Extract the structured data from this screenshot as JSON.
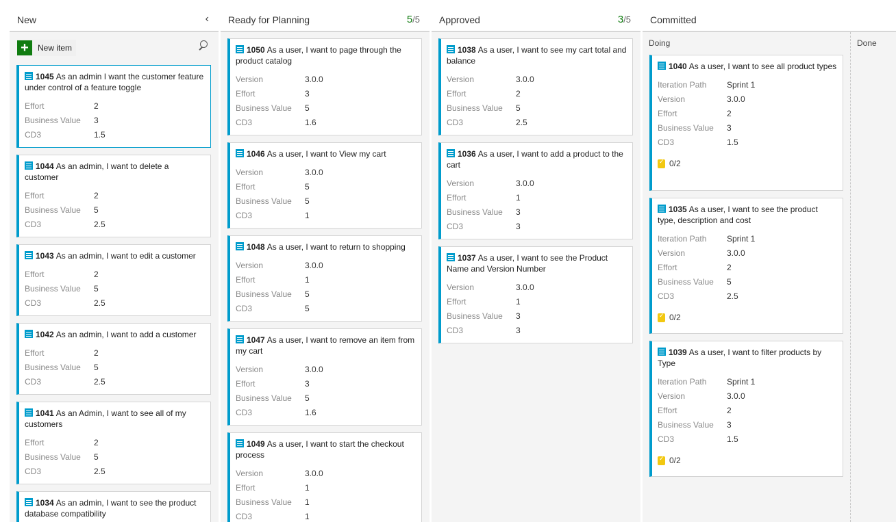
{
  "columns": {
    "new": {
      "title": "New",
      "new_item_label": "New item"
    },
    "ready": {
      "title": "Ready for Planning",
      "count": "5",
      "limit": "/5"
    },
    "approved": {
      "title": "Approved",
      "count": "3",
      "limit": "/5"
    },
    "committed": {
      "title": "Committed",
      "doing": "Doing",
      "done": "Done"
    }
  },
  "field_labels": {
    "effort": "Effort",
    "business_value": "Business Value",
    "cd3": "CD3",
    "version": "Version",
    "iteration_path": "Iteration Path"
  },
  "cards": {
    "c1045": {
      "id": "1045",
      "title": "As an admin I want the customer feature under control of a feature toggle",
      "effort": "2",
      "business_value": "3",
      "cd3": "1.5"
    },
    "c1044": {
      "id": "1044",
      "title": "As an admin, I want to delete a customer",
      "effort": "2",
      "business_value": "5",
      "cd3": "2.5"
    },
    "c1043": {
      "id": "1043",
      "title": "As an admin, I want to edit a customer",
      "effort": "2",
      "business_value": "5",
      "cd3": "2.5"
    },
    "c1042": {
      "id": "1042",
      "title": "As an admin, I want to add a customer",
      "effort": "2",
      "business_value": "5",
      "cd3": "2.5"
    },
    "c1041": {
      "id": "1041",
      "title": "As an Admin, I want to see all of my customers",
      "effort": "2",
      "business_value": "5",
      "cd3": "2.5"
    },
    "c1034": {
      "id": "1034",
      "title": "As an admin, I want to see the product database compatibility"
    },
    "c1050": {
      "id": "1050",
      "title": "As a user, I want to page through the product catalog",
      "version": "3.0.0",
      "effort": "3",
      "business_value": "5",
      "cd3": "1.6"
    },
    "c1046": {
      "id": "1046",
      "title": "As a user, I want to View my cart",
      "version": "3.0.0",
      "effort": "5",
      "business_value": "5",
      "cd3": "1"
    },
    "c1048": {
      "id": "1048",
      "title": "As a user, I want to return to shopping",
      "version": "3.0.0",
      "effort": "1",
      "business_value": "5",
      "cd3": "5"
    },
    "c1047": {
      "id": "1047",
      "title": "As a user, I want to remove an item from my cart",
      "version": "3.0.0",
      "effort": "3",
      "business_value": "5",
      "cd3": "1.6"
    },
    "c1049": {
      "id": "1049",
      "title": "As a user, I want to start the checkout process",
      "version": "3.0.0",
      "effort": "1",
      "business_value": "1",
      "cd3": "1"
    },
    "c1038": {
      "id": "1038",
      "title": "As a user, I want to see my cart total and balance",
      "version": "3.0.0",
      "effort": "2",
      "business_value": "5",
      "cd3": "2.5"
    },
    "c1036": {
      "id": "1036",
      "title": "As a user, I want to add a product to the cart",
      "version": "3.0.0",
      "effort": "1",
      "business_value": "3",
      "cd3": "3"
    },
    "c1037": {
      "id": "1037",
      "title": "As a user, I want to see the Product Name and Version Number",
      "version": "3.0.0",
      "effort": "1",
      "business_value": "3",
      "cd3": "3"
    },
    "c1040": {
      "id": "1040",
      "title": "As a user, I want to see all product types",
      "iteration_path": "Sprint 1",
      "version": "3.0.0",
      "effort": "2",
      "business_value": "3",
      "cd3": "1.5",
      "tasks": "0/2"
    },
    "c1035": {
      "id": "1035",
      "title": "As a user, I want to see the product type, description and cost",
      "iteration_path": "Sprint 1",
      "version": "3.0.0",
      "effort": "2",
      "business_value": "5",
      "cd3": "2.5",
      "tasks": "0/2"
    },
    "c1039": {
      "id": "1039",
      "title": "As a user, I want to filter products by Type",
      "iteration_path": "Sprint 1",
      "version": "3.0.0",
      "effort": "2",
      "business_value": "3",
      "cd3": "1.5",
      "tasks": "0/2"
    }
  },
  "colors": {
    "accent": "#009ccc",
    "count_green": "#107c10",
    "task_yellow": "#f2c811"
  },
  "icons": {
    "collapse": "chevron-left-icon",
    "search": "search-icon",
    "work_item": "backlog-item-icon",
    "task": "task-clipboard-icon"
  }
}
